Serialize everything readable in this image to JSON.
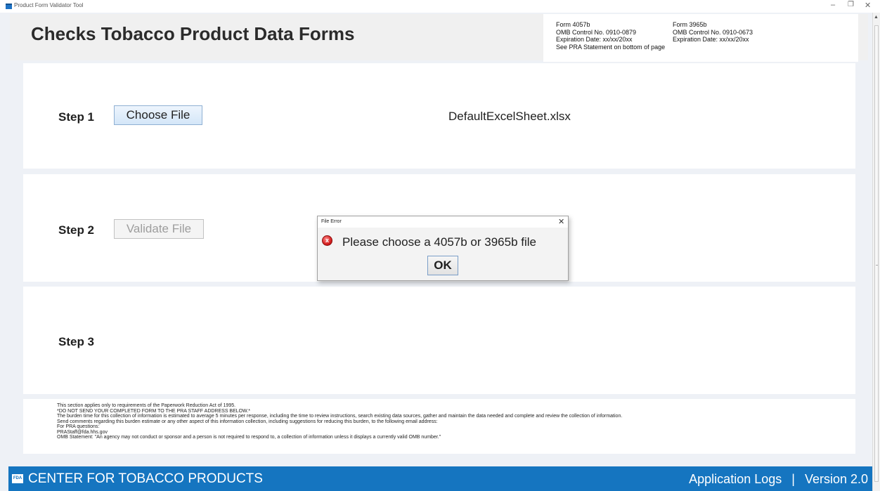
{
  "window": {
    "title": "Product Form Validator Tool",
    "minimize_glyph": "–",
    "maximize_glyph": "❐",
    "close_glyph": "✕"
  },
  "header": {
    "title": "Checks Tobacco Product Data Forms",
    "form_4057b": {
      "form": "Form 4057b",
      "omb": "OMB Control No. 0910-0879",
      "expiration": "Expiration Date: xx/xx/20xx",
      "note": "See PRA Statement on bottom of page"
    },
    "form_3965b": {
      "form": "Form 3965b",
      "omb": "OMB Control No. 0910-0673",
      "expiration": "Expiration Date: xx/xx/20xx"
    }
  },
  "steps": {
    "step1": {
      "label": "Step 1",
      "button": "Choose File",
      "file_name": "DefaultExcelSheet.xlsx"
    },
    "step2": {
      "label": "Step 2",
      "button": "Validate File",
      "button_enabled": false
    },
    "step3": {
      "label": "Step 3"
    }
  },
  "pra": {
    "lines": [
      "This section applies only to requirements of the Paperwork Reduction Act of 1995.",
      "*DO NOT SEND YOUR COMPLETED FORM TO THE PRA STAFF ADDRESS BELOW.*",
      "The burden time for this collection of information is estimated to average 5 minutes per response, including the time to review instructions, search existing data sources, gather and maintain the data needed and complete and review the collection of information.",
      "Send comments regarding this burden estimate or any other aspect of this information collection, including suggestions for reducing this burden, to the following email address:",
      "For PRA questions:",
      "PRAStaff@fda.hhs.gov",
      "OMB Statement: \"An agency may not conduct or sponsor and a person is not required to respond to, a collection of information unless it displays a currently valid OMB number.\""
    ]
  },
  "footer": {
    "logo_text": "FDA",
    "title": "CENTER FOR TOBACCO PRODUCTS",
    "logs_link": "Application Logs",
    "separator": "|",
    "version": "Version 2.0",
    "background_color": "#1575c0"
  },
  "dialog": {
    "title": "File Error",
    "close_glyph": "✕",
    "icon": "error-icon",
    "icon_glyph": "x",
    "message": "Please choose a 4057b or 3965b file",
    "ok_label": "OK"
  },
  "colors": {
    "page_background": "#eef1f6",
    "error_red": "#d42020"
  }
}
